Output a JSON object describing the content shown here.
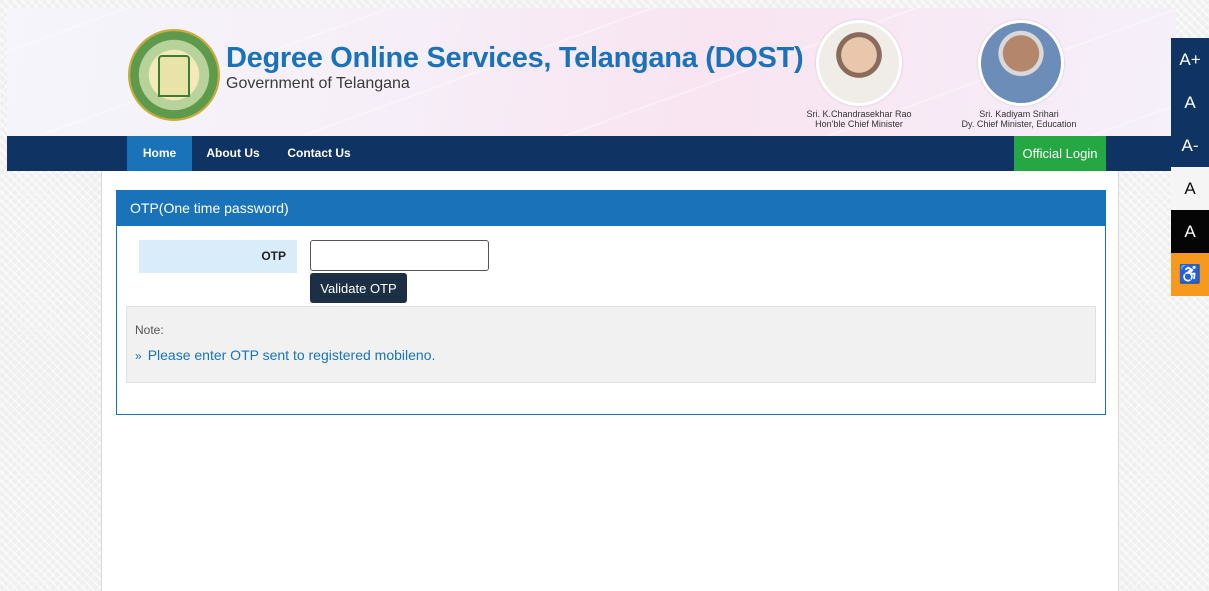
{
  "header": {
    "title": "Degree Online Services, Telangana (DOST)",
    "subtitle": "Government of Telangana",
    "emblem_icon": "telangana-emblem",
    "leaders": [
      {
        "name": "Sri. K.Chandrasekhar Rao",
        "role": "Hon'ble Chief Minister"
      },
      {
        "name": "Sri. Kadiyam Srihari",
        "role": "Dy. Chief Minister, Education"
      }
    ]
  },
  "nav": {
    "items": [
      {
        "label": "Home",
        "active": true
      },
      {
        "label": "About Us"
      },
      {
        "label": "Contact Us"
      }
    ],
    "login_label": "Official Login"
  },
  "accessibility": {
    "increase": "A+",
    "normal": "A",
    "decrease": "A-",
    "light_theme": "A",
    "dark_theme": "A",
    "accessibility_icon": "♿"
  },
  "panel": {
    "heading": "OTP(One time password)",
    "otp_label": "OTP",
    "otp_value": "",
    "validate_label": "Validate OTP",
    "note_title": "Note:",
    "notes": [
      "Please enter OTP sent to registered mobileno."
    ]
  },
  "colors": {
    "primary": "#1a73b8",
    "navbar": "#0f3363",
    "login": "#25a843",
    "accessibility_orange": "#f59a1e"
  }
}
